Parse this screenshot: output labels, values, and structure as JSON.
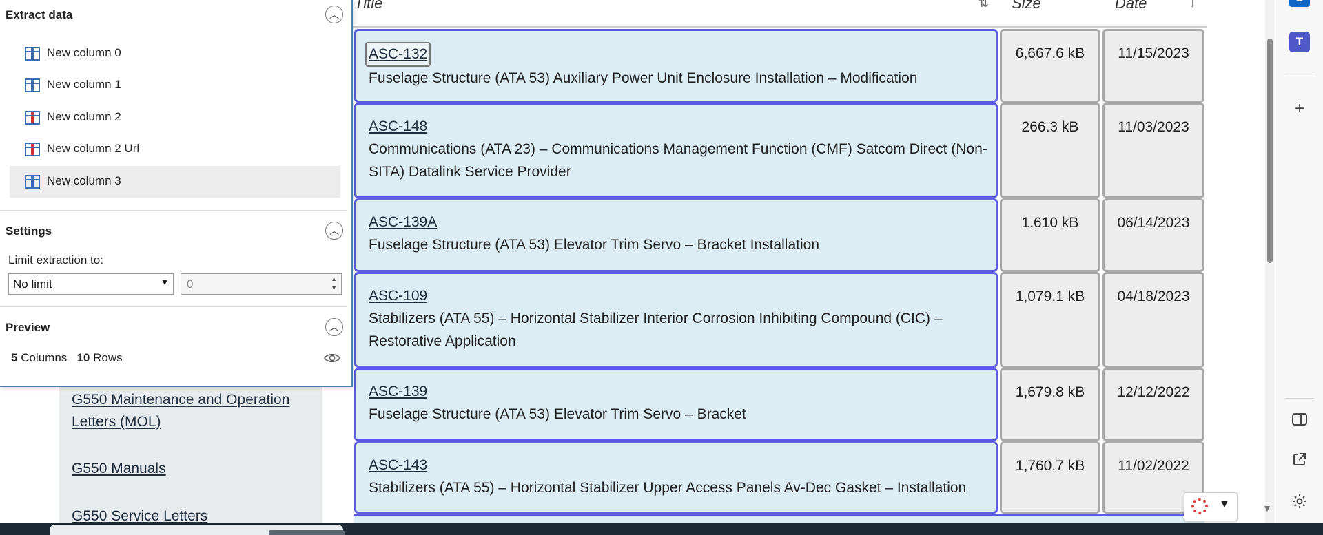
{
  "panel": {
    "extract_title": "Extract data",
    "columns": [
      {
        "label": "New column 0",
        "icon": "table-column-icon",
        "accent": "blue"
      },
      {
        "label": "New column 1",
        "icon": "table-column-icon",
        "accent": "blue"
      },
      {
        "label": "New column 2",
        "icon": "table-column-icon",
        "accent": "red"
      },
      {
        "label": "New column 2 Url",
        "icon": "table-column-icon",
        "accent": "red"
      },
      {
        "label": "New column 3",
        "icon": "table-column-icon",
        "accent": "blue",
        "selected": true
      }
    ],
    "settings_title": "Settings",
    "limit_label": "Limit extraction to:",
    "limit_select": "No limit",
    "limit_value": "0",
    "preview_title": "Preview",
    "preview_columns_count": "5",
    "preview_columns_word": "Columns",
    "preview_rows_count": "10",
    "preview_rows_word": "Rows"
  },
  "nav": {
    "links": [
      "G550 Maintenance and Operation Letters (MOL)",
      "G550 Manuals",
      "G550 Service Letters"
    ]
  },
  "table": {
    "headers": {
      "title": "Title",
      "size": "Size",
      "date": "Date"
    },
    "rows": [
      {
        "id": "ASC-132",
        "desc": "Fuselage Structure (ATA 53) Auxiliary Power Unit Enclosure Installation – Modification",
        "size": "6,667.6 kB",
        "date": "11/15/2023"
      },
      {
        "id": "ASC-148",
        "desc": "Communications (ATA 23) – Communications Management Function (CMF) Satcom Direct (Non-SITA) Datalink Service Provider",
        "size": "266.3 kB",
        "date": "11/03/2023"
      },
      {
        "id": "ASC-139A",
        "desc": "Fuselage Structure (ATA 53) Elevator Trim Servo – Bracket Installation",
        "size": "1,610 kB",
        "date": "06/14/2023"
      },
      {
        "id": "ASC-109",
        "desc": "Stabilizers (ATA 55) – Horizontal Stabilizer Interior Corrosion Inhibiting Compound (CIC) – Restorative Application",
        "size": "1,079.1 kB",
        "date": "04/18/2023"
      },
      {
        "id": "ASC-139",
        "desc": "Fuselage Structure (ATA 53) Elevator Trim Servo – Bracket",
        "size": "1,679.8 kB",
        "date": "12/12/2022"
      },
      {
        "id": "ASC-143",
        "desc": "Stabilizers (ATA 55) – Horizontal Stabilizer Upper Access Panels Av-Dec Gasket – Installation",
        "size": "1,760.7 kB",
        "date": "11/02/2022"
      }
    ]
  },
  "sidebar_icons": [
    "outlook-icon",
    "teams-icon",
    "add-icon",
    "split-screen-icon",
    "open-external-icon",
    "settings-gear-icon"
  ]
}
